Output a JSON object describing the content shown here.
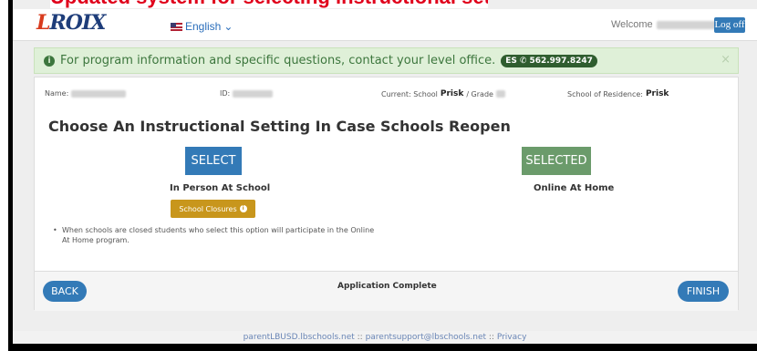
{
  "header": {
    "banner_text": "Updated system for selecting instructional setting",
    "logo_text": "LROIX",
    "language": "English",
    "welcome": "Welcome",
    "logoff_label": "Log off"
  },
  "alert": {
    "message": "For program information and specific questions, contact your level office.",
    "badge_level": "ES",
    "badge_phone": "562.997.8247",
    "close": "×"
  },
  "student": {
    "name_label": "Name:",
    "id_label": "ID:",
    "current_label": "Current: School",
    "current_school": "Prisk",
    "grade_label": "/ Grade",
    "residence_label": "School of Residence:",
    "residence_school": "Prisk"
  },
  "main": {
    "heading": "Choose An Instructional Setting In Case Schools Reopen",
    "option1": {
      "button": "SELECT",
      "label": "In Person At School"
    },
    "option2": {
      "button": "SELECTED",
      "label": "Online At Home"
    },
    "closures_label": "School Closures",
    "note": "When schools are closed students who select this option will participate in the Online At Home program."
  },
  "card_footer": {
    "back": "BACK",
    "status": "Application Complete",
    "finish": "FINISH"
  },
  "footer": {
    "link1": "parentLBUSD.lbschools.net",
    "sep": " :: ",
    "link2": "parentsupport@lbschools.net",
    "link3": "Privacy"
  },
  "colors": {
    "primary": "#337ab7",
    "success_bg": "#dff0d8",
    "selected": "#6b9b6b",
    "warning": "#c8961c"
  }
}
